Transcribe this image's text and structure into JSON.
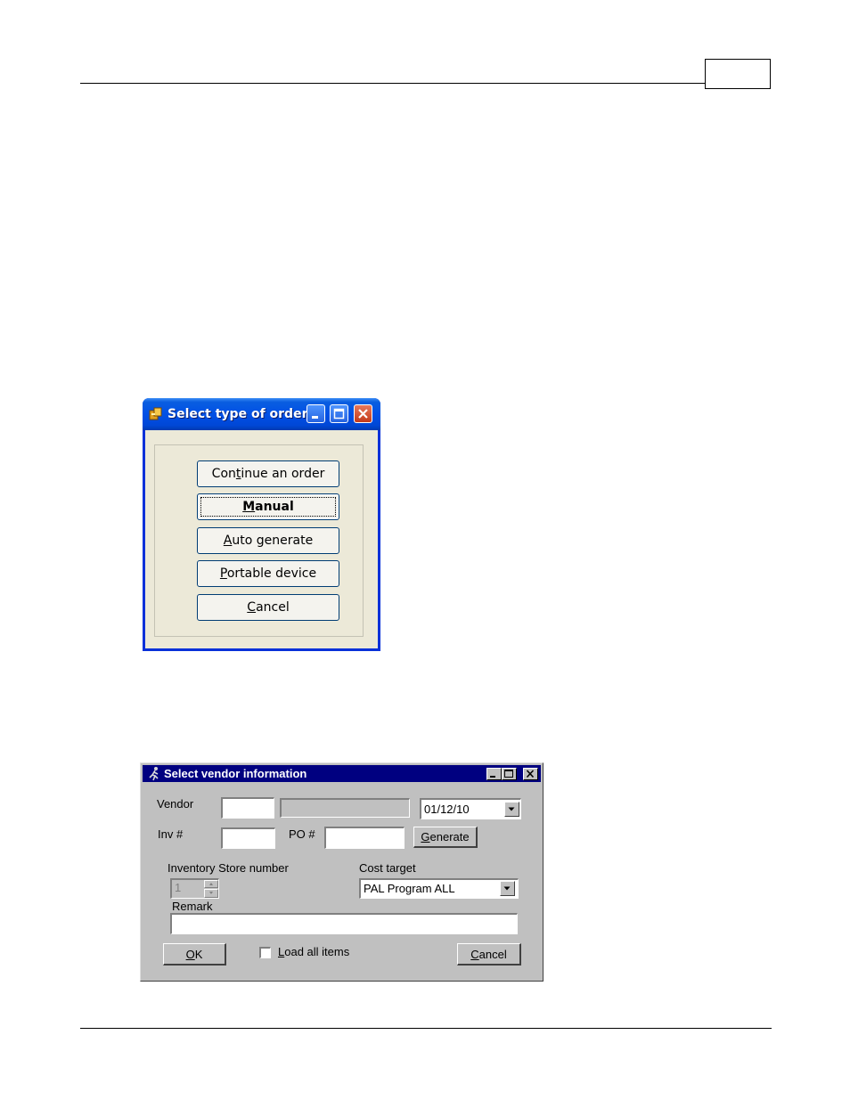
{
  "dialog_order": {
    "title": "Select type of order",
    "buttons": [
      {
        "pre": "Con",
        "key": "t",
        "post": "inue an order"
      },
      {
        "pre": "",
        "key": "M",
        "post": "anual"
      },
      {
        "pre": "",
        "key": "A",
        "post": "uto generate"
      },
      {
        "pre": "",
        "key": "P",
        "post": "ortable device"
      },
      {
        "pre": "",
        "key": "C",
        "post": "ancel"
      }
    ]
  },
  "dialog_vendor": {
    "title": "Select vendor information",
    "vendor_label": "Vendor",
    "vendor_value": "",
    "vendor_name": "",
    "date_value": "01/12/10",
    "inv_label": "Inv #",
    "inv_value": "",
    "po_label": "PO #",
    "po_value": "",
    "generate": {
      "pre": "",
      "key": "G",
      "post": "enerate"
    },
    "store_label": "Inventory Store number",
    "store_value": "1",
    "cost_label": "Cost target",
    "cost_value": "PAL Program ALL",
    "remark_label": "Remark",
    "remark_value": "",
    "ok": {
      "pre": "",
      "key": "O",
      "post": "K"
    },
    "load_all": {
      "pre": "",
      "key": "L",
      "post": "oad all items"
    },
    "cancel": {
      "pre": "",
      "key": "C",
      "post": "ancel"
    }
  }
}
